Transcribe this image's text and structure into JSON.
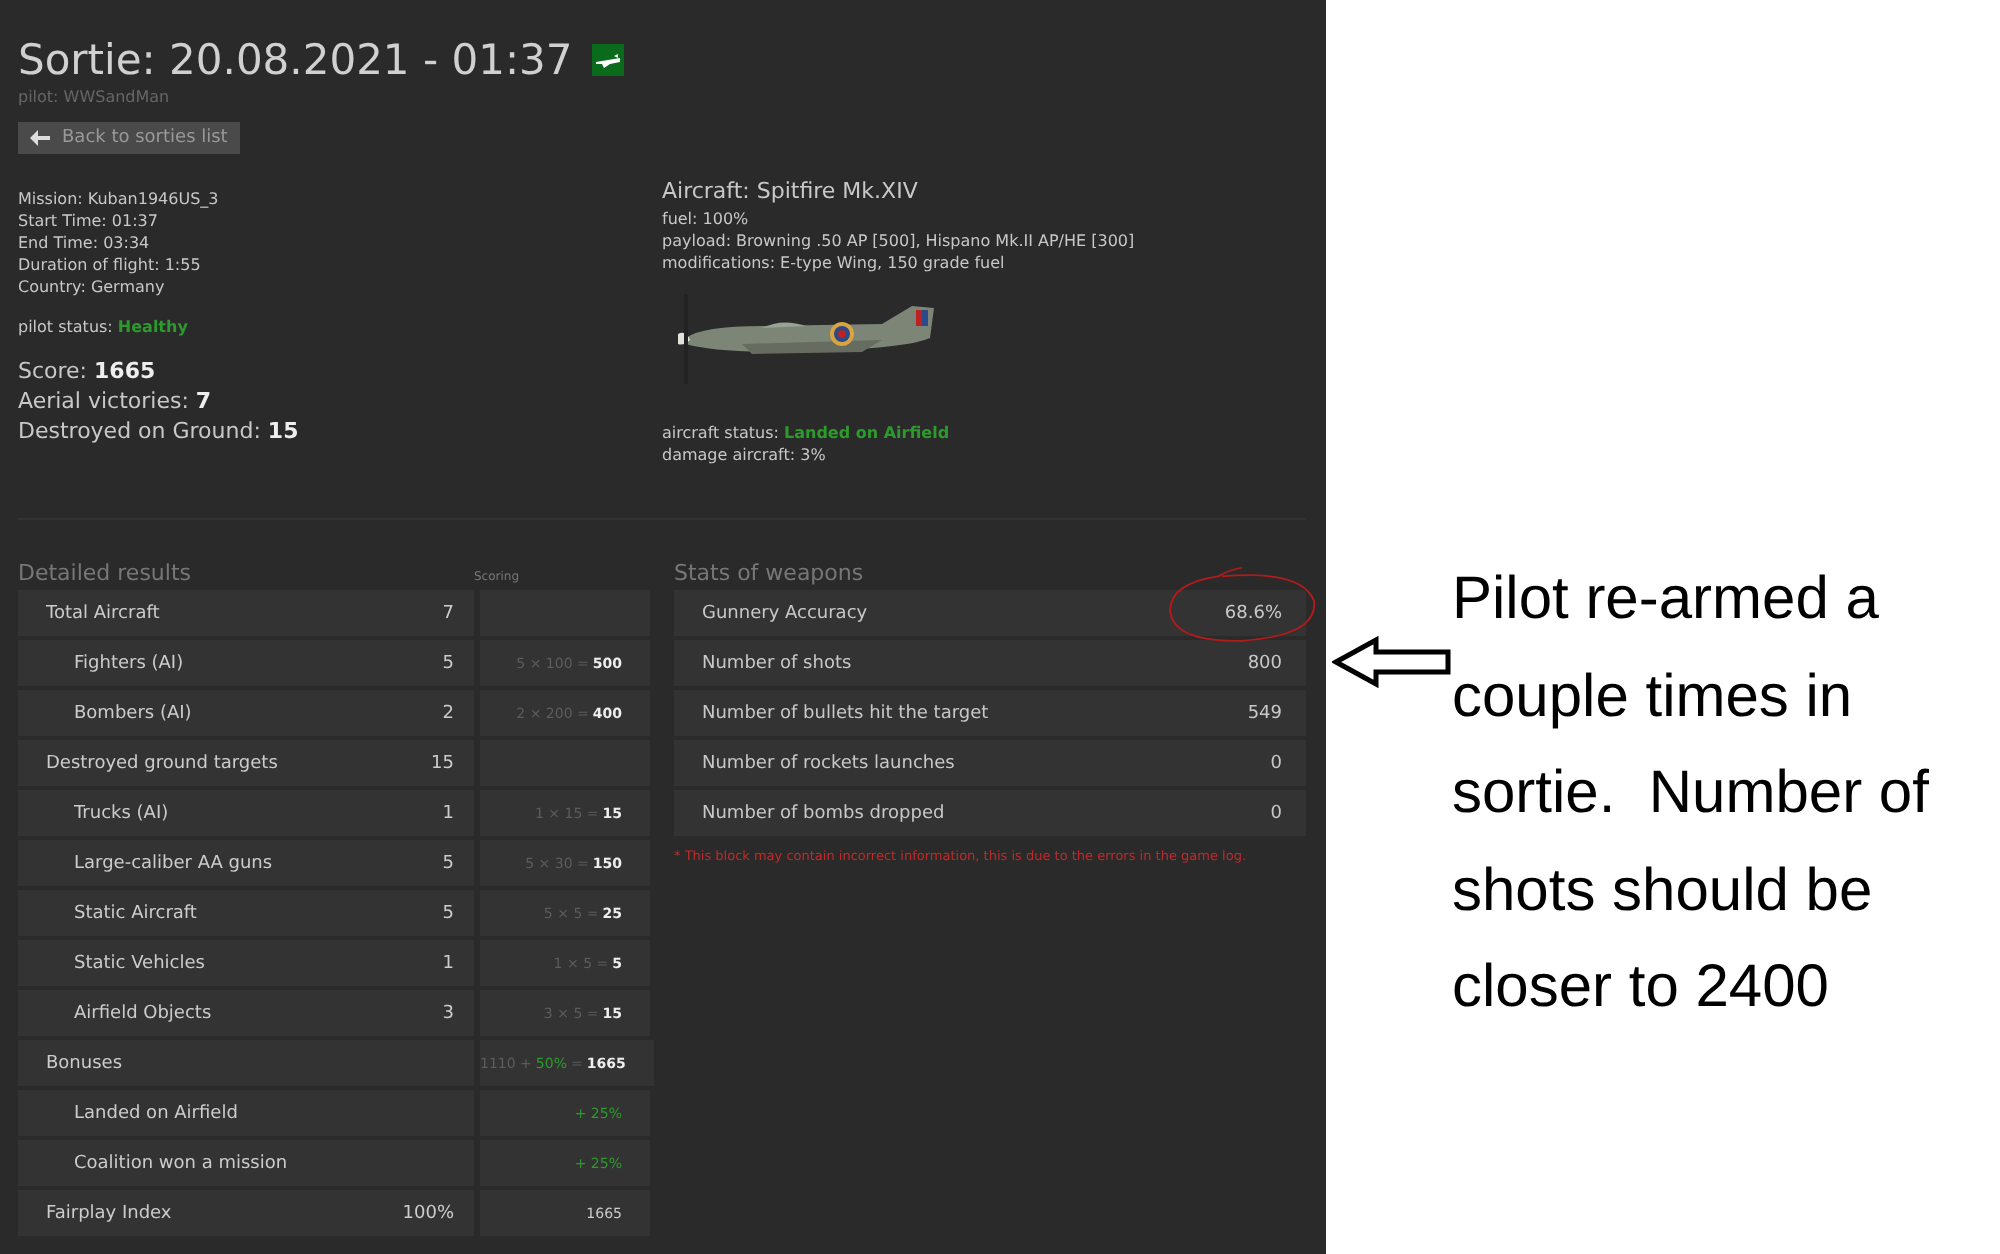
{
  "header": {
    "title": "Sortie: 20.08.2021 - 01:37",
    "pilot": "pilot: WWSandMan",
    "back_button": "Back to sorties list"
  },
  "mission_info": [
    "Mission: Kuban1946US_3",
    "Start Time: 01:37",
    "End Time: 03:34",
    "Duration of flight: 1:55",
    "Country: Germany"
  ],
  "pilot_status": {
    "label": "pilot status:",
    "value": "Healthy",
    "kind": "good"
  },
  "totals": [
    {
      "label": "Score:",
      "value": "1665"
    },
    {
      "label": "Aerial victories:",
      "value": "7"
    },
    {
      "label": "Destroyed on Ground:",
      "value": "15"
    }
  ],
  "aircraft": {
    "title": "Aircraft: Spitfire Mk.XIV",
    "details": [
      "fuel: 100%",
      "payload: Browning .50 AP [500], Hispano Mk.II AP/HE [300]",
      "modifications: E-type Wing, 150 grade fuel"
    ],
    "image": {
      "kind": "picture"
    },
    "status": {
      "label": "aircraft status:",
      "value": "Landed on Airfield",
      "kind": "good"
    },
    "damage": "damage aircraft: 3%"
  },
  "detailed_results": {
    "title": "Detailed results",
    "scoring_heading": "Scoring",
    "rows": [
      {
        "label": "Total Aircraft",
        "count": "7",
        "children": [
          {
            "label": "Fighters (AI)",
            "count": "5",
            "score": [
              {
                "text": "5 × 100 =",
                "kind": "dim"
              },
              {
                "text": "500",
                "kind": "bright"
              }
            ]
          },
          {
            "label": "Bombers (AI)",
            "count": "2",
            "score": [
              {
                "text": "2 × 200 =",
                "kind": "dim"
              },
              {
                "text": "400",
                "kind": "bright"
              }
            ]
          }
        ]
      },
      {
        "label": "Destroyed ground targets",
        "count": "15",
        "children": [
          {
            "label": "Trucks (AI)",
            "count": "1",
            "score": [
              {
                "text": "1 × 15 =",
                "kind": "dim"
              },
              {
                "text": "15",
                "kind": "bright"
              }
            ]
          },
          {
            "label": "Large-caliber AA guns",
            "count": "5",
            "score": [
              {
                "text": "5 × 30 =",
                "kind": "dim"
              },
              {
                "text": "150",
                "kind": "bright"
              }
            ]
          },
          {
            "label": "Static Aircraft",
            "count": "5",
            "score": [
              {
                "text": "5 × 5 =",
                "kind": "dim"
              },
              {
                "text": "25",
                "kind": "bright"
              }
            ]
          },
          {
            "label": "Static Vehicles",
            "count": "1",
            "score": [
              {
                "text": "1 × 5 =",
                "kind": "dim"
              },
              {
                "text": "5",
                "kind": "bright"
              }
            ]
          },
          {
            "label": "Airfield Objects",
            "count": "3",
            "score": [
              {
                "text": "3 × 5 =",
                "kind": "dim"
              },
              {
                "text": "15",
                "kind": "bright"
              }
            ]
          }
        ]
      },
      {
        "label": "Bonuses",
        "score": [
          {
            "text": "1110 +",
            "kind": "dim"
          },
          {
            "text": "50%",
            "kind": "green"
          },
          {
            "text": "=",
            "kind": "dim"
          },
          {
            "text": "1665",
            "kind": "bright"
          }
        ],
        "children": [
          {
            "label": "Landed on Airfield",
            "score": [
              {
                "text": "+ 25%",
                "kind": "green"
              }
            ]
          },
          {
            "label": "Coalition won a mission",
            "score": [
              {
                "text": "+ 25%",
                "kind": "green"
              }
            ]
          }
        ]
      },
      {
        "label": "Fairplay Index",
        "count": "100%",
        "score": [
          {
            "text": "1665",
            "kind": "normal"
          }
        ]
      }
    ]
  },
  "weapon_stats": {
    "title": "Stats of weapons",
    "rows": [
      {
        "label": "Gunnery Accuracy",
        "value": "68.6%"
      },
      {
        "label": "Number of shots",
        "value": "800"
      },
      {
        "label": "Number of bullets hit the target",
        "value": "549"
      },
      {
        "label": "Number of rockets launches",
        "value": "0"
      },
      {
        "label": "Number of bombs dropped",
        "value": "0"
      }
    ],
    "note": "* This block may contain incorrect information, this is due to the errors in the game log."
  },
  "annotation": {
    "text": "Pilot re-armed a couple times in sortie.  Number of shots should be closer to 2400"
  }
}
